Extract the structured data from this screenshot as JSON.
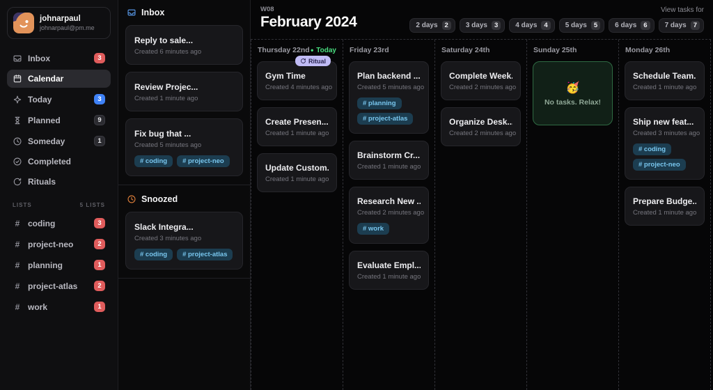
{
  "sidebar": {
    "user": {
      "name": "johnarpaul",
      "email": "johnarpaul@pm.me"
    },
    "nav": [
      {
        "label": "Inbox",
        "icon": "inbox",
        "badge": "3",
        "badge_color": "red",
        "active": false
      },
      {
        "label": "Calendar",
        "icon": "calendar",
        "active": true
      },
      {
        "label": "Today",
        "icon": "sparkle",
        "badge": "3",
        "badge_color": "blue",
        "active": false
      },
      {
        "label": "Planned",
        "icon": "hourglass",
        "badge": "9",
        "badge_color": "gray",
        "active": false
      },
      {
        "label": "Someday",
        "icon": "clock",
        "badge": "1",
        "badge_color": "gray",
        "active": false
      },
      {
        "label": "Completed",
        "icon": "check-circle",
        "active": false
      },
      {
        "label": "Rituals",
        "icon": "refresh",
        "active": false
      }
    ],
    "lists_header": "LISTS",
    "lists_count": "5 LISTS",
    "lists": [
      {
        "label": "coding",
        "badge": "3"
      },
      {
        "label": "project-neo",
        "badge": "2"
      },
      {
        "label": "planning",
        "badge": "1"
      },
      {
        "label": "project-atlas",
        "badge": "2"
      },
      {
        "label": "work",
        "badge": "1"
      }
    ]
  },
  "inbox_panel": {
    "inbox_title": "Inbox",
    "snoozed_title": "Snoozed",
    "inbox_tasks": [
      {
        "title": "Reply to sale...",
        "meta": "Created 6 minutes ago",
        "tags": []
      },
      {
        "title": "Review Projec...",
        "meta": "Created 1 minute ago",
        "tags": []
      },
      {
        "title": "Fix bug that ...",
        "meta": "Created 5 minutes ago",
        "tags": [
          "# coding",
          "# project-neo"
        ]
      }
    ],
    "snoozed_tasks": [
      {
        "title": "Slack Integra...",
        "meta": "Created 3 minutes ago",
        "tags": [
          "# coding",
          "# project-atlas"
        ]
      }
    ]
  },
  "main": {
    "week_label": "W08",
    "title": "February 2024",
    "view_tasks_label": "View tasks for",
    "view_buttons": [
      {
        "label": "2 days",
        "key": "2"
      },
      {
        "label": "3 days",
        "key": "3"
      },
      {
        "label": "4 days",
        "key": "4"
      },
      {
        "label": "5 days",
        "key": "5"
      },
      {
        "label": "6 days",
        "key": "6"
      },
      {
        "label": "7 days",
        "key": "7"
      }
    ],
    "columns": [
      {
        "header": "Thursday 22nd",
        "today": true,
        "today_label": "Today",
        "tasks": [
          {
            "title": "Gym Time",
            "meta": "Created 4 minutes ago",
            "ritual": "Ritual",
            "tags": []
          },
          {
            "title": "Create Presen...",
            "meta": "Created 1 minute ago",
            "tags": []
          },
          {
            "title": "Update Custom...",
            "meta": "Created 1 minute ago",
            "tags": []
          }
        ]
      },
      {
        "header": "Friday 23rd",
        "tasks": [
          {
            "title": "Plan backend ...",
            "meta": "Created 5 minutes ago",
            "tags": [
              "# planning",
              "# project-atlas"
            ]
          },
          {
            "title": "Brainstorm Cr...",
            "meta": "Created 1 minute ago",
            "tags": []
          },
          {
            "title": "Research New ...",
            "meta": "Created 2 minutes ago",
            "tags": [
              "# work"
            ]
          },
          {
            "title": "Evaluate Empl...",
            "meta": "Created 1 minute ago",
            "tags": []
          }
        ]
      },
      {
        "header": "Saturday 24th",
        "tasks": [
          {
            "title": "Complete Week...",
            "meta": "Created 2 minutes ago",
            "tags": []
          },
          {
            "title": "Organize Desk...",
            "meta": "Created 2 minutes ago",
            "tags": []
          }
        ]
      },
      {
        "header": "Sunday 25th",
        "empty": {
          "emoji": "🥳",
          "message": "No tasks. Relax!"
        }
      },
      {
        "header": "Monday 26th",
        "tasks": [
          {
            "title": "Schedule Team...",
            "meta": "Created 1 minute ago",
            "tags": []
          },
          {
            "title": "Ship new feat...",
            "meta": "Created 3 minutes ago",
            "tags": [
              "# coding",
              "# project-neo"
            ]
          },
          {
            "title": "Prepare Budge...",
            "meta": "Created 1 minute ago",
            "tags": []
          }
        ]
      }
    ]
  },
  "colors": {
    "accent_red": "#E05C5C",
    "accent_blue": "#3F82F7",
    "tag_bg": "#1C3D50",
    "tag_text": "#79C7EF",
    "today_green": "#4ADE80",
    "empty_border": "#2F6B43",
    "ritual_badge_bg": "#C0BBF5"
  }
}
